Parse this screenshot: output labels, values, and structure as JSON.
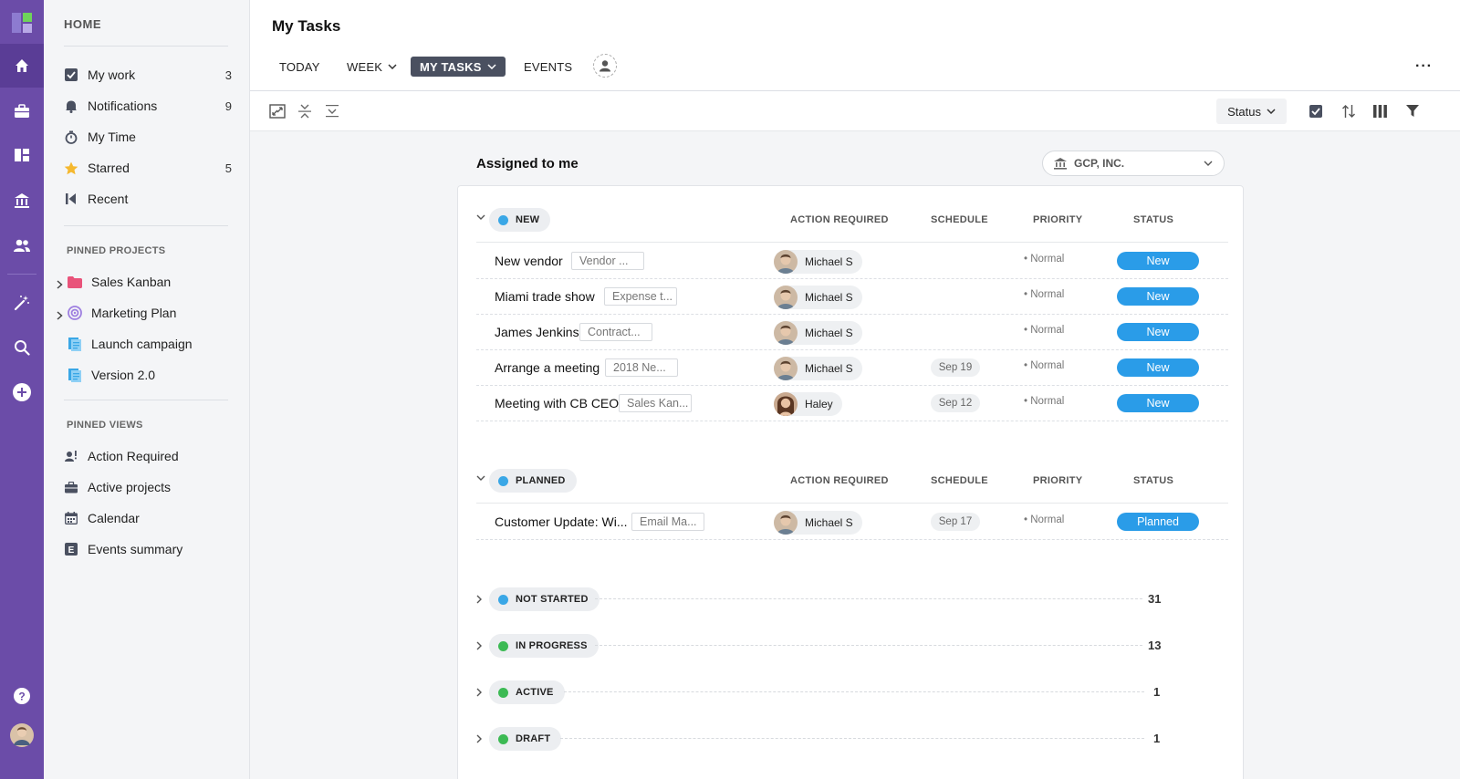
{
  "sidebar": {
    "home_label": "HOME",
    "nav": [
      {
        "label": "My work",
        "count": "3",
        "icon": "checkbox-icon"
      },
      {
        "label": "Notifications",
        "count": "9",
        "icon": "bell-icon"
      },
      {
        "label": "My Time",
        "count": "",
        "icon": "stopwatch-icon"
      },
      {
        "label": "Starred",
        "count": "5",
        "icon": "star-icon"
      },
      {
        "label": "Recent",
        "count": "",
        "icon": "recent-icon"
      }
    ],
    "pinned_projects_label": "PINNED PROJECTS",
    "pinned_projects": [
      {
        "label": "Sales Kanban",
        "icon": "folder-icon"
      },
      {
        "label": "Marketing Plan",
        "icon": "target-icon"
      },
      {
        "label": "Launch campaign",
        "icon": "document-icon"
      },
      {
        "label": "Version 2.0",
        "icon": "document-icon"
      }
    ],
    "pinned_views_label": "PINNED VIEWS",
    "pinned_views": [
      {
        "label": "Action Required",
        "icon": "user-alert-icon"
      },
      {
        "label": "Active projects",
        "icon": "briefcase-icon"
      },
      {
        "label": "Calendar",
        "icon": "calendar-icon"
      },
      {
        "label": "Events summary",
        "icon": "events-icon"
      }
    ]
  },
  "header": {
    "title": "My Tasks",
    "tabs": [
      {
        "label": "TODAY"
      },
      {
        "label": "WEEK"
      },
      {
        "label": "MY TASKS"
      },
      {
        "label": "EVENTS"
      }
    ],
    "more_label": "···"
  },
  "toolbar": {
    "group_by_label": "Status"
  },
  "content": {
    "assigned_label": "Assigned to me",
    "company_label": "GCP, INC.",
    "columns": {
      "action_required": "ACTION REQUIRED",
      "schedule": "SCHEDULE",
      "priority": "PRIORITY",
      "status": "STATUS"
    },
    "groups": [
      {
        "label": "NEW",
        "color": "#3aa7e6",
        "rows": [
          {
            "name": "New vendor",
            "project": "Vendor ...",
            "assignee": "Michael S",
            "schedule": "",
            "priority": "• Normal",
            "status": "New"
          },
          {
            "name": "Miami trade show",
            "project": "Expense t...",
            "assignee": "Michael S",
            "schedule": "",
            "priority": "• Normal",
            "status": "New"
          },
          {
            "name": "James Jenkins",
            "project": "Contract...",
            "assignee": "Michael S",
            "schedule": "",
            "priority": "• Normal",
            "status": "New"
          },
          {
            "name": "Arrange a meeting",
            "project": "2018 Ne...",
            "assignee": "Michael S",
            "schedule": "Sep 19",
            "priority": "• Normal",
            "status": "New"
          },
          {
            "name": "Meeting with CB CEO",
            "project": "Sales Kan...",
            "assignee": "Haley",
            "schedule": "Sep 12",
            "priority": "• Normal",
            "status": "New"
          }
        ]
      },
      {
        "label": "PLANNED",
        "color": "#3aa7e6",
        "rows": [
          {
            "name": "Customer Update: Wi...",
            "project": "Email Ma...",
            "assignee": "Michael S",
            "schedule": "Sep 17",
            "priority": "• Normal",
            "status": "Planned"
          }
        ]
      }
    ],
    "collapsed_groups": [
      {
        "label": "NOT STARTED",
        "color": "#3aa7e6",
        "count": "31"
      },
      {
        "label": "IN PROGRESS",
        "color": "#3cba54",
        "count": "13"
      },
      {
        "label": "ACTIVE",
        "color": "#3cba54",
        "count": "1"
      },
      {
        "label": "DRAFT",
        "color": "#3cba54",
        "count": "1"
      }
    ]
  }
}
